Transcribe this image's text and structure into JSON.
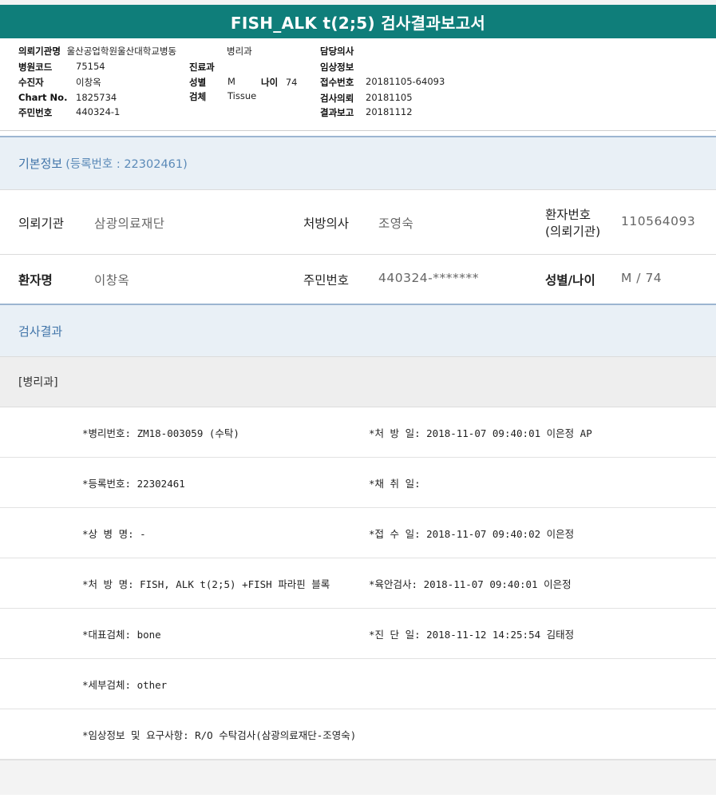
{
  "report": {
    "title": "FISH_ALK t(2;5) 검사결과보고서"
  },
  "header": {
    "c1": [
      {
        "label": "의뢰기관명",
        "value": "울산공업학원울산대학교병동"
      },
      {
        "label": "병원코드",
        "value": "75154"
      },
      {
        "label": "수진자",
        "value": "이창옥"
      },
      {
        "label": "Chart No.",
        "value": "1825734"
      },
      {
        "label": "주민번호",
        "value": "440324-1"
      }
    ],
    "ward_value": "병리과",
    "c2": [
      {
        "label": "진료과",
        "value": ""
      },
      {
        "label": "성별",
        "value": "M"
      },
      {
        "label": "검체",
        "value": "Tissue"
      }
    ],
    "age_label": "나이",
    "age_value": "74",
    "c3": [
      {
        "label": "담당의사",
        "value": ""
      },
      {
        "label": "임상정보",
        "value": ""
      },
      {
        "label": "접수번호",
        "value": "20181105-64093"
      },
      {
        "label": "검사의뢰",
        "value": "20181105"
      },
      {
        "label": "결과보고",
        "value": "20181112"
      }
    ]
  },
  "basic": {
    "title": "기본정보",
    "sub": "(등록번호 : 22302461)",
    "row1": {
      "inst_label": "의뢰기관",
      "inst_value": "삼광의료재단",
      "doctor_label": "처방의사",
      "doctor_value": "조영숙",
      "pid_label_1": "환자번호",
      "pid_label_2": "(의뢰기관)",
      "pid_value": "110564093"
    },
    "row2": {
      "name_label": "환자명",
      "name_value": "이창옥",
      "rrn_label": "주민번호",
      "rrn_value": "440324-*******",
      "sexage_label": "성별/나이",
      "sexage_value": "M / 74"
    }
  },
  "results": {
    "title": "검사결과",
    "dept": "[병리과]",
    "rows": [
      {
        "left": "*병리번호: ZM18-003059 (수탁)",
        "right": "*처 방 일: 2018-11-07 09:40:01  이은정 AP"
      },
      {
        "left": "*등록번호: 22302461",
        "right": "*채 취 일:"
      },
      {
        "left": "*상 병 명: -",
        "right": "*접 수 일: 2018-11-07 09:40:02  이은정"
      },
      {
        "left": "*처 방 명: FISH, ALK t(2;5) +FISH 파라핀 블록",
        "right": "*육안검사: 2018-11-07 09:40:01  이은정"
      },
      {
        "left": "*대표검체: bone",
        "right": "*진 단 일: 2018-11-12 14:25:54  김태정"
      },
      {
        "left": "*세부검체: other",
        "right": ""
      },
      {
        "left": "*임상정보 및 요구사항: R/O 수탁검사(삼광의료재단-조영숙)",
        "right": ""
      }
    ]
  }
}
